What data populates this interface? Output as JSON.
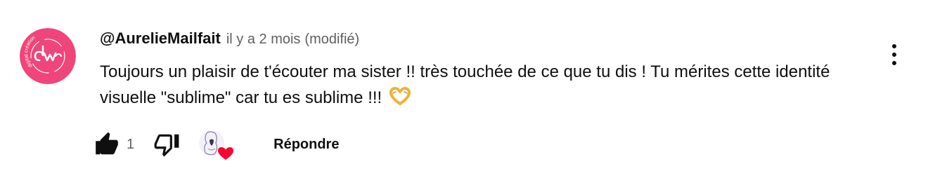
{
  "comment": {
    "author": "@AurelieMailfait",
    "published": "il y a 2 mois",
    "edited": "(modifié)",
    "text": "Toujours un plaisir de t'écouter ma sister !! très touchée de ce que tu dis ! Tu mérites cette identité visuelle \"sublime\" car tu es sublime !!!",
    "emoji": "heart-hands",
    "avatar": {
      "background": "#f0457a",
      "monogram": "dw",
      "arc_text": "digital création"
    }
  },
  "actions": {
    "like_count": "1",
    "reply_label": "Répondre",
    "liked": true
  },
  "icons": {
    "like": "thumb-up-filled-icon",
    "dislike": "thumb-down-outline-icon",
    "menu": "more-vert-icon",
    "creator_heart": "creator-heart-icon"
  },
  "colors": {
    "accent_pink": "#f0457a",
    "heart_red": "#ff0033",
    "secondary_text": "#606060",
    "primary_text": "#0f0f0f"
  }
}
